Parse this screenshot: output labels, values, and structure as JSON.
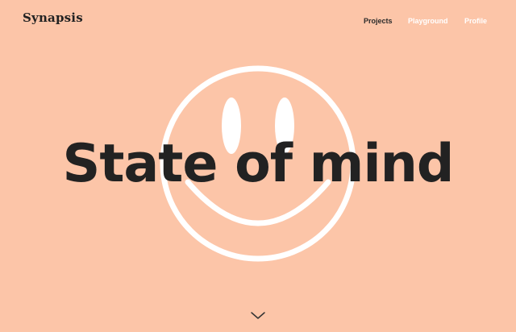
{
  "brand": {
    "logo_text": "Synapsis"
  },
  "nav": {
    "items": [
      {
        "label": "Projects",
        "active": true
      },
      {
        "label": "Playground",
        "active": false
      },
      {
        "label": "Profile",
        "active": false
      }
    ]
  },
  "hero": {
    "headline": "State of mind",
    "graphic_icon": "smiley-face-icon"
  },
  "scroll": {
    "icon": "chevron-down-icon"
  },
  "colors": {
    "background": "#FCC5A8",
    "text_dark": "#222222",
    "nav_inactive": "#ffffff",
    "graphic": "#ffffff"
  }
}
